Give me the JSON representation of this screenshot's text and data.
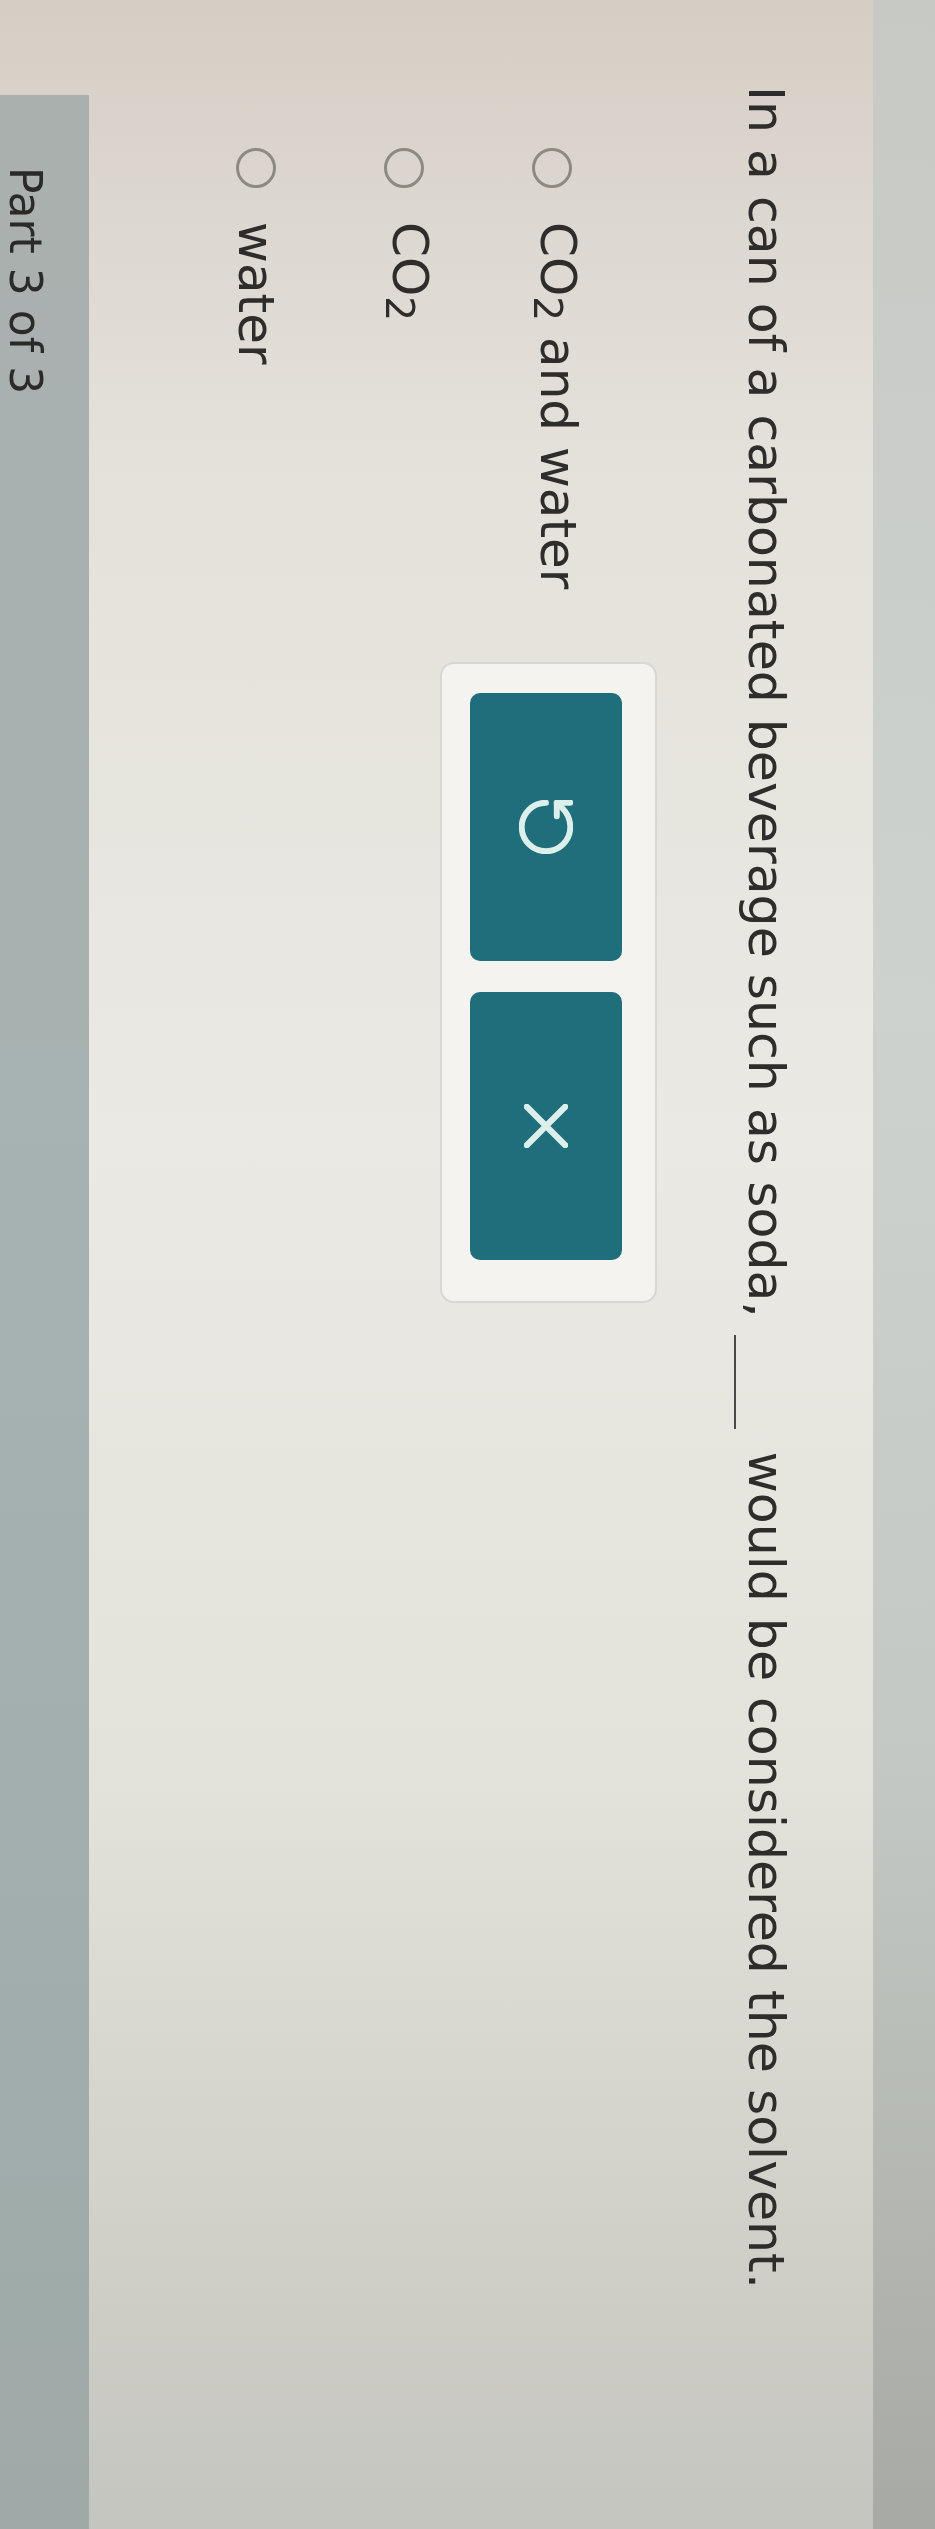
{
  "question": {
    "parts": [
      {
        "kind": "text",
        "text": "In a can of a carbonated beverage such as soda,"
      },
      {
        "kind": "blank"
      },
      {
        "kind": "text",
        "text": "would be considered the solvent."
      }
    ]
  },
  "options": [
    {
      "label": "CO$_{2}$ and water",
      "selected": false
    },
    {
      "label": "CO$_{2}$",
      "selected": false
    },
    {
      "label": "water",
      "selected": false
    }
  ],
  "tools": [
    {
      "kind": "reset"
    },
    {
      "kind": "clear"
    }
  ],
  "footer": {
    "progress": "Part 3 of 3"
  }
}
